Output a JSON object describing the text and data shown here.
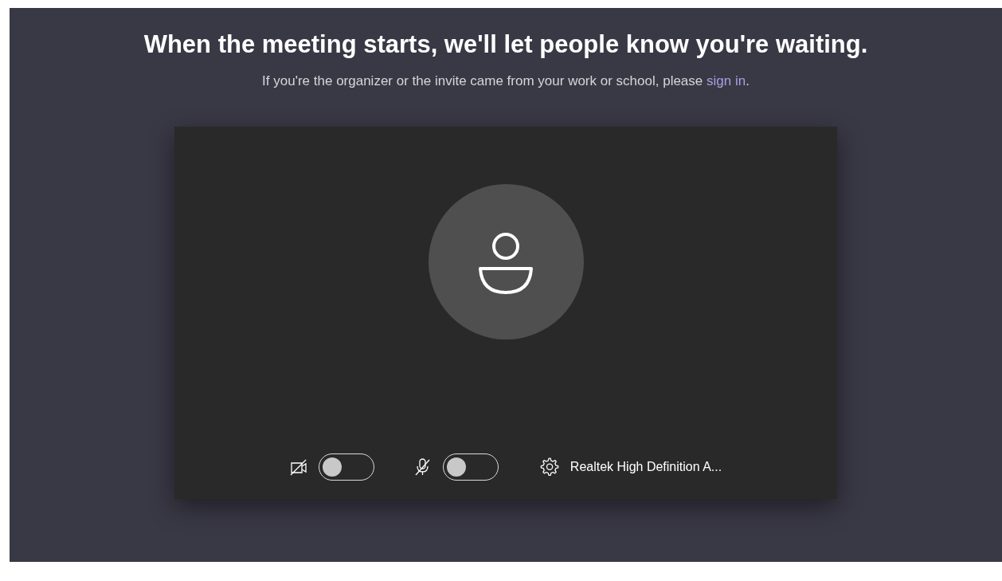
{
  "heading": "When the meeting starts, we'll let people know you're waiting.",
  "subtitle": {
    "text_before": "If you're the organizer or the invite came from your work or school, please ",
    "link": "sign in",
    "text_after": "."
  },
  "preview": {
    "controls": [
      {
        "kind": "camera",
        "on": false
      },
      {
        "kind": "microphone",
        "on": false
      }
    ],
    "device": "Realtek High Definition A..."
  }
}
